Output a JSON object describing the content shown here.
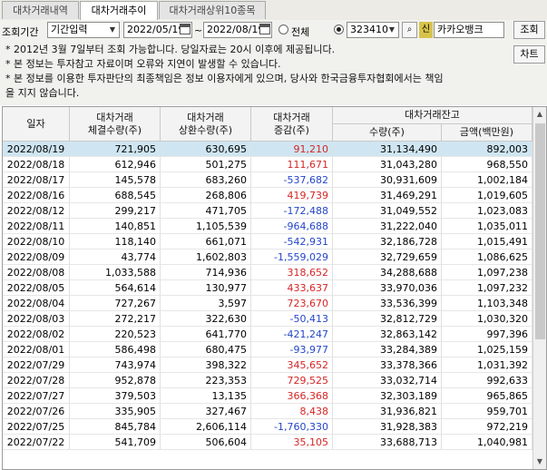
{
  "tabs": [
    "대차거래내역",
    "대차거래추이",
    "대차거래상위10종목"
  ],
  "active_tab": 1,
  "toolbar": {
    "period_label": "조회기간",
    "period_type": "기간입력",
    "date_from": "2022/05/19",
    "date_to": "2022/08/19",
    "tilde": "~",
    "all_label": "전체",
    "code": "323410",
    "shin_badge": "신",
    "stock_name": "카카오뱅크",
    "query_button": "조회",
    "chart_button": "차트"
  },
  "notes": [
    "* 2012년 3월 7일부터 조회 가능합니다. 당일자료는 20시 이후에 제공됩니다.",
    "* 본 정보는 투자참고 자료이며 오류와 지연이 발생할 수 있습니다.",
    "* 본 정보를 이용한 투자판단의 최종책임은 정보 이용자에게 있으며, 당사와 한국금융투자협회에서는 책임",
    "  을 지지 않습니다."
  ],
  "table": {
    "headers": {
      "date": "일자",
      "exec_line1": "대차거래",
      "exec_line2": "체결수량(주)",
      "repay_line1": "대차거래",
      "repay_line2": "상환수량(주)",
      "change_line1": "대차거래",
      "change_line2": "증감(주)",
      "balance": "대차거래잔고",
      "balance_qty": "수량(주)",
      "balance_amount": "금액(백만원)"
    },
    "rows": [
      {
        "date": "2022/08/19",
        "exec": "721,905",
        "repay": "630,695",
        "change": "91,210",
        "qty": "31,134,490",
        "amount": "892,003",
        "dir": "up",
        "selected": true
      },
      {
        "date": "2022/08/18",
        "exec": "612,946",
        "repay": "501,275",
        "change": "111,671",
        "qty": "31,043,280",
        "amount": "968,550",
        "dir": "up"
      },
      {
        "date": "2022/08/17",
        "exec": "145,578",
        "repay": "683,260",
        "change": "-537,682",
        "qty": "30,931,609",
        "amount": "1,002,184",
        "dir": "dn"
      },
      {
        "date": "2022/08/16",
        "exec": "688,545",
        "repay": "268,806",
        "change": "419,739",
        "qty": "31,469,291",
        "amount": "1,019,605",
        "dir": "up"
      },
      {
        "date": "2022/08/12",
        "exec": "299,217",
        "repay": "471,705",
        "change": "-172,488",
        "qty": "31,049,552",
        "amount": "1,023,083",
        "dir": "dn"
      },
      {
        "date": "2022/08/11",
        "exec": "140,851",
        "repay": "1,105,539",
        "change": "-964,688",
        "qty": "31,222,040",
        "amount": "1,035,011",
        "dir": "dn"
      },
      {
        "date": "2022/08/10",
        "exec": "118,140",
        "repay": "661,071",
        "change": "-542,931",
        "qty": "32,186,728",
        "amount": "1,015,491",
        "dir": "dn"
      },
      {
        "date": "2022/08/09",
        "exec": "43,774",
        "repay": "1,602,803",
        "change": "-1,559,029",
        "qty": "32,729,659",
        "amount": "1,086,625",
        "dir": "dn"
      },
      {
        "date": "2022/08/08",
        "exec": "1,033,588",
        "repay": "714,936",
        "change": "318,652",
        "qty": "34,288,688",
        "amount": "1,097,238",
        "dir": "up"
      },
      {
        "date": "2022/08/05",
        "exec": "564,614",
        "repay": "130,977",
        "change": "433,637",
        "qty": "33,970,036",
        "amount": "1,097,232",
        "dir": "up"
      },
      {
        "date": "2022/08/04",
        "exec": "727,267",
        "repay": "3,597",
        "change": "723,670",
        "qty": "33,536,399",
        "amount": "1,103,348",
        "dir": "up"
      },
      {
        "date": "2022/08/03",
        "exec": "272,217",
        "repay": "322,630",
        "change": "-50,413",
        "qty": "32,812,729",
        "amount": "1,030,320",
        "dir": "dn"
      },
      {
        "date": "2022/08/02",
        "exec": "220,523",
        "repay": "641,770",
        "change": "-421,247",
        "qty": "32,863,142",
        "amount": "997,396",
        "dir": "dn"
      },
      {
        "date": "2022/08/01",
        "exec": "586,498",
        "repay": "680,475",
        "change": "-93,977",
        "qty": "33,284,389",
        "amount": "1,025,159",
        "dir": "dn"
      },
      {
        "date": "2022/07/29",
        "exec": "743,974",
        "repay": "398,322",
        "change": "345,652",
        "qty": "33,378,366",
        "amount": "1,031,392",
        "dir": "up"
      },
      {
        "date": "2022/07/28",
        "exec": "952,878",
        "repay": "223,353",
        "change": "729,525",
        "qty": "33,032,714",
        "amount": "992,633",
        "dir": "up"
      },
      {
        "date": "2022/07/27",
        "exec": "379,503",
        "repay": "13,135",
        "change": "366,368",
        "qty": "32,303,189",
        "amount": "965,865",
        "dir": "up"
      },
      {
        "date": "2022/07/26",
        "exec": "335,905",
        "repay": "327,467",
        "change": "8,438",
        "qty": "31,936,821",
        "amount": "959,701",
        "dir": "up"
      },
      {
        "date": "2022/07/25",
        "exec": "845,784",
        "repay": "2,606,114",
        "change": "-1,760,330",
        "qty": "31,928,383",
        "amount": "972,219",
        "dir": "dn"
      },
      {
        "date": "2022/07/22",
        "exec": "541,709",
        "repay": "506,604",
        "change": "35,105",
        "qty": "33,688,713",
        "amount": "1,040,981",
        "dir": "up"
      }
    ]
  },
  "colors": {
    "positive": "#d62525",
    "negative": "#2546c8",
    "selected_row": "#cfe6f2"
  }
}
